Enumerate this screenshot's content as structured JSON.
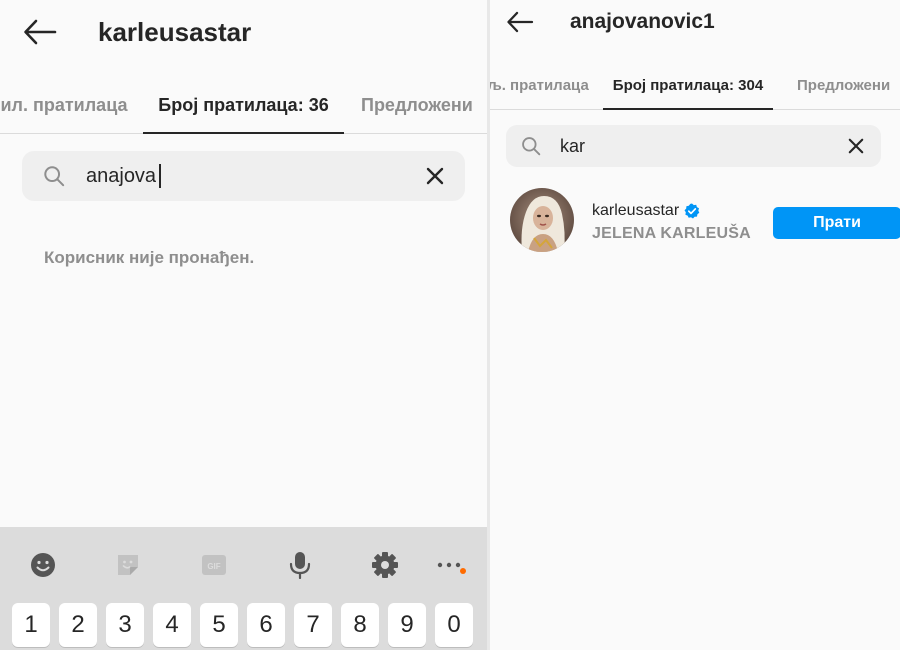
{
  "left": {
    "header": {
      "title": "karleusastar"
    },
    "tabs": [
      {
        "label": "ил. пратилаца",
        "active": false
      },
      {
        "label": "Број пратилаца: 36",
        "active": true
      },
      {
        "label": "Предложени",
        "active": false
      }
    ],
    "search": {
      "value": "anajova"
    },
    "empty_message": "Корисник није пронађен.",
    "keyboard": {
      "tools": [
        "emoji-icon",
        "sticker-icon",
        "gif-icon",
        "microphone-icon",
        "settings-icon",
        "more-icon"
      ],
      "gif_label": "GIF",
      "keys": [
        "1",
        "2",
        "3",
        "4",
        "5",
        "6",
        "7",
        "8",
        "9",
        "0"
      ]
    }
  },
  "right": {
    "header": {
      "title": "anajovanovic1"
    },
    "tabs": [
      {
        "label": "љ. пратилаца",
        "active": false
      },
      {
        "label": "Број пратилаца: 304",
        "active": true
      },
      {
        "label": "Предложени",
        "active": false
      }
    ],
    "search": {
      "value": "kar"
    },
    "result": {
      "username": "karleusastar",
      "full_name": "JELENA KARLEUŠA",
      "verified": true,
      "follow_label": "Прати"
    }
  },
  "colors": {
    "accent": "#0095f6",
    "text": "#262626",
    "muted": "#8e8e8e",
    "search_bg": "#efefef",
    "keyboard_bg": "#dcdcdc",
    "badge": "#ff6b00"
  }
}
